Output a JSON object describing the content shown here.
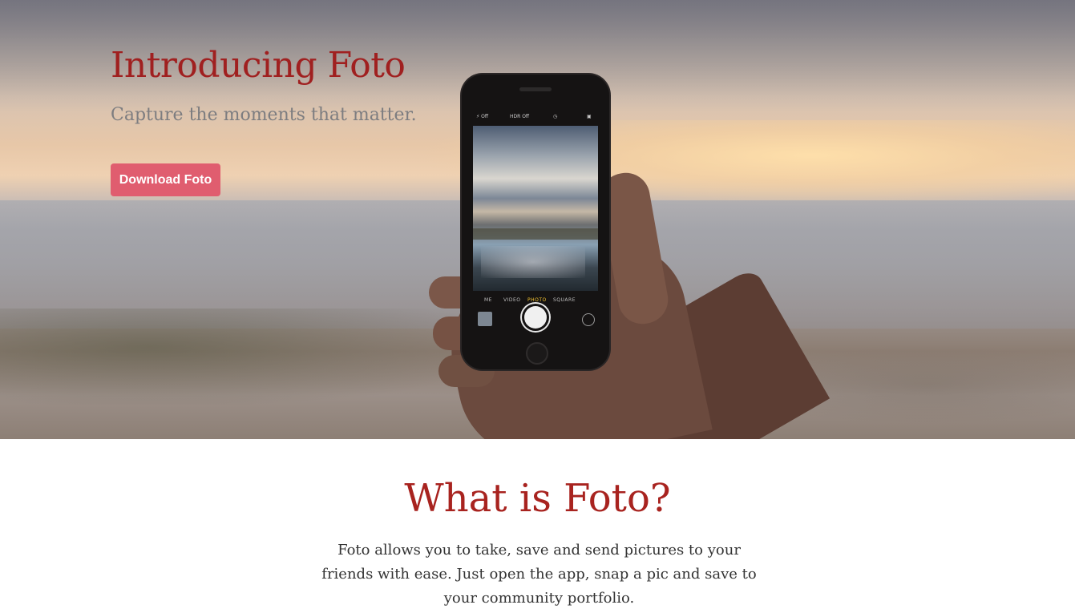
{
  "hero": {
    "title": "Introducing Foto",
    "subtitle": "Capture the moments that matter.",
    "cta_label": "Download Foto",
    "phone": {
      "flash": "⚡ Off",
      "hdr": "HDR Off",
      "modes": [
        "ME",
        "VIDEO",
        "PHOTO",
        "SQUARE"
      ],
      "active_mode": "PHOTO"
    }
  },
  "about": {
    "heading": "What is Foto?",
    "body": "Foto allows you to take, save and send pictures to your friends with ease. Just open the app, snap a pic and save to your community portfolio."
  },
  "colors": {
    "title_red": "#a02020",
    "button_pink": "#e05d6f",
    "heading_red": "#a8231f"
  }
}
